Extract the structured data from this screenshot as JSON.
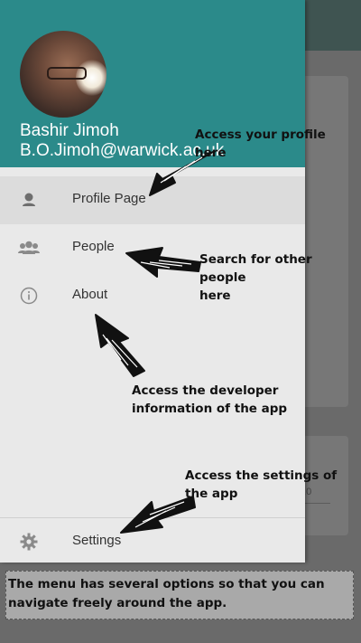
{
  "profile": {
    "name": "Bashir Jimoh",
    "email": "B.O.Jimoh@warwick.ac.uk"
  },
  "menu": {
    "items": [
      {
        "label": "Profile Page",
        "icon": "person-icon"
      },
      {
        "label": "People",
        "icon": "people-icon"
      },
      {
        "label": "About",
        "icon": "info-icon"
      },
      {
        "label": "Settings",
        "icon": "gear-icon"
      }
    ]
  },
  "background": {
    "card_value": "0.0"
  },
  "annotations": {
    "profile": "Access your profile here",
    "people_line1": "Search for other people",
    "people_line2": "here",
    "about_line1": "Access the developer",
    "about_line2": "information of the app",
    "settings_line1": "Access the settings of",
    "settings_line2": "the app"
  },
  "caption": "The menu has several options so that you can navigate freely around the app.",
  "colors": {
    "header": "#2b8a8a",
    "drawer": "#e9e9e9",
    "overlay": "#6a6a6a"
  }
}
